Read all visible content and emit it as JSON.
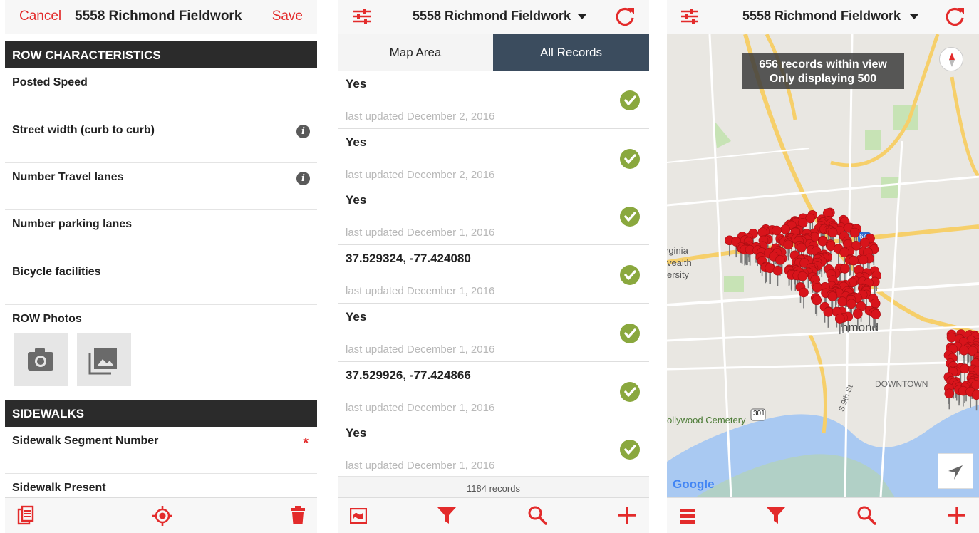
{
  "form": {
    "nav": {
      "cancel": "Cancel",
      "title": "5558 Richmond Fieldwork",
      "save": "Save"
    },
    "sections": [
      {
        "title": "ROW CHARACTERISTICS"
      },
      {
        "title": "SIDEWALKS"
      }
    ],
    "fields": [
      {
        "label": "Posted Speed",
        "info": false
      },
      {
        "label": "Street width (curb to curb)",
        "info": true
      },
      {
        "label": "Number Travel lanes",
        "info": true
      },
      {
        "label": "Number parking lanes",
        "info": false
      },
      {
        "label": "Bicycle facilities",
        "info": false
      },
      {
        "label": "ROW Photos",
        "info": false
      }
    ],
    "sidewalk_fields": [
      {
        "label": "Sidewalk Segment Number",
        "required_mark": "*"
      },
      {
        "label": "Sidewalk Present"
      }
    ],
    "info_glyph": "i",
    "photo_buttons": [
      "camera-icon",
      "gallery-icon"
    ],
    "toolbar": [
      "duplicate-icon",
      "location-target-icon",
      "trash-icon"
    ]
  },
  "records": {
    "nav": {
      "title": "5558 Richmond Fieldwork"
    },
    "tabs": [
      {
        "label": "Map Area",
        "active": false
      },
      {
        "label": "All Records",
        "active": true
      }
    ],
    "items": [
      {
        "title": "Yes",
        "date": "last updated December 2, 2016"
      },
      {
        "title": "Yes",
        "date": "last updated December 2, 2016"
      },
      {
        "title": "Yes",
        "date": "last updated December 1, 2016"
      },
      {
        "title": "37.529324, -77.424080",
        "date": "last updated December 1, 2016"
      },
      {
        "title": "Yes",
        "date": "last updated December 1, 2016"
      },
      {
        "title": "37.529926, -77.424866",
        "date": "last updated December 1, 2016"
      },
      {
        "title": "Yes",
        "date": "last updated December 1, 2016"
      }
    ],
    "count": "1184 records",
    "toolbar": [
      "map-icon",
      "filter-icon",
      "search-icon",
      "add-icon"
    ]
  },
  "map": {
    "nav": {
      "title": "5558 Richmond Fieldwork"
    },
    "banner": {
      "line1": "656 records within view",
      "line2": "Only displaying 500"
    },
    "labels": {
      "virginia": "rginia",
      "wealth": "vealth",
      "ersity": "ersity",
      "richmond": "hmond",
      "downtown": "DOWNTOWN",
      "cemetery": "ollywood Cemetery",
      "street": "S 9th St",
      "route301": "301",
      "route64": "64"
    },
    "google": "Google",
    "toolbar": [
      "list-icon",
      "filter-icon",
      "search-icon",
      "add-icon"
    ]
  },
  "colors": {
    "accent": "#e32b2b",
    "tab_active": "#3b4c5e",
    "check": "#8aa83e",
    "pin": "#d8141b"
  }
}
